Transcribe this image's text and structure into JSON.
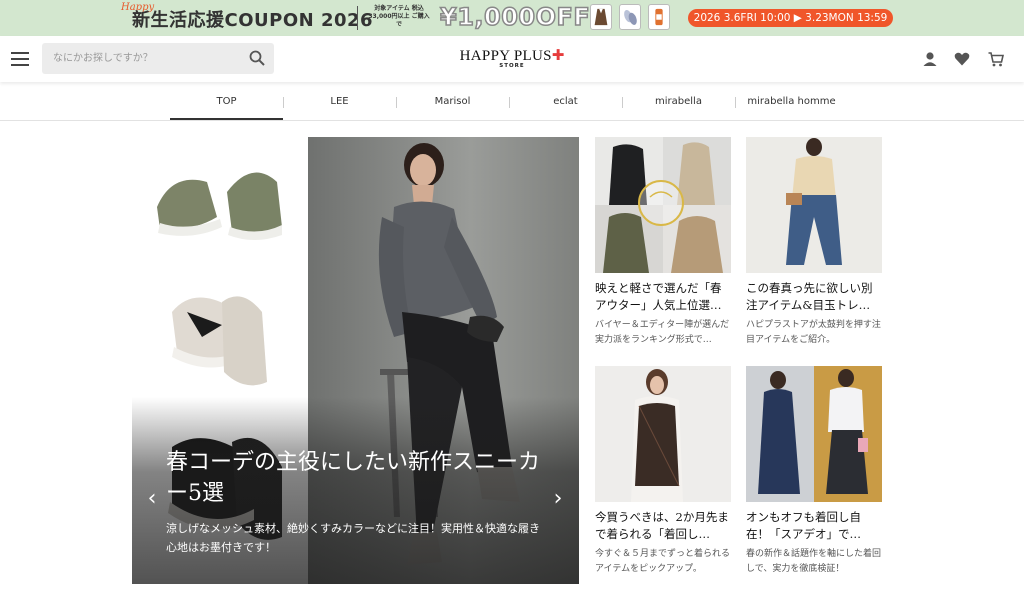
{
  "promo": {
    "happy": "Happy",
    "title_prefix": "新生活応援",
    "title_coupon": "COUPON 2026",
    "conditions": "対象アイテム 税込33,000円以上 ご購入で",
    "discount": "¥1,000OFF",
    "dates": "2026 3.6FRI 10:00 ▶ 3.23MON 13:59"
  },
  "header": {
    "search_placeholder": "なにかお探しですか？",
    "logo_main": "HAPPY PLUS",
    "logo_plus": "✚",
    "logo_sub": "STORE"
  },
  "nav": {
    "tabs": [
      "TOP",
      "LEE",
      "Marisol",
      "eclat",
      "mirabella",
      "mirabella homme"
    ],
    "active": "TOP"
  },
  "hero": {
    "title": "春コーデの主役にしたい新作スニーカー5選",
    "subtitle": "涼しげなメッシュ素材、絶妙くすみカラーなどに注目！実用性＆快適な履き心地はお墨付きです！",
    "prev": "‹",
    "next": "›"
  },
  "cards": [
    {
      "title": "映えと軽さで選んだ「春アウター」人気上位選…",
      "desc": "バイヤー＆エディター陣が選んだ実力派をランキング形式で…"
    },
    {
      "title": "この春真っ先に欲しい別注アイテム&目玉トレ…",
      "desc": "ハピプラストアが太鼓判を押す注目アイテムをご紹介。"
    },
    {
      "title": "今買うべきは、2か月先まで着られる「着回し…",
      "desc": "今すぐ＆５月までずっと着られるアイテムをピックアップ。"
    },
    {
      "title": "オンもオフも着回し自在！「スアデオ」で…",
      "desc": "春の新作＆話題作を軸にした着回しで、実力を徹底検証！"
    }
  ],
  "colors": {
    "promo_bg": "#d3e7cf",
    "date_pill": "#f0562a",
    "logo_cross": "#e63c3c"
  }
}
